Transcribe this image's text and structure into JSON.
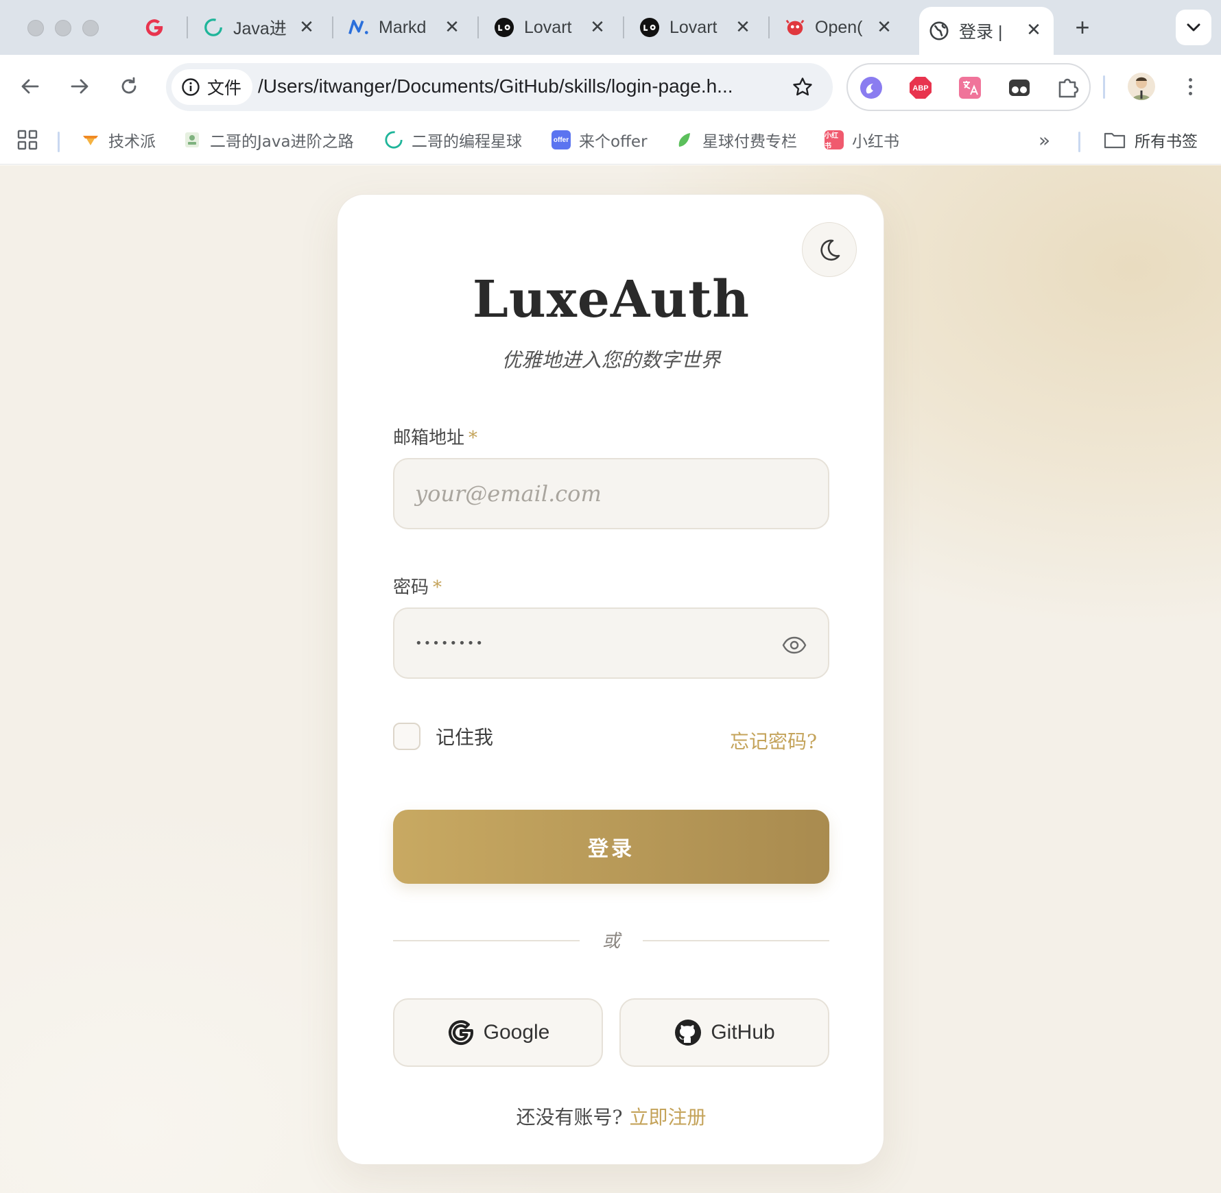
{
  "browser": {
    "tabs": [
      {
        "title": "",
        "icon": "google-g-icon"
      },
      {
        "title": "Java进",
        "icon": "spinner-icon"
      },
      {
        "title": "Markd",
        "icon": "markdown-n-icon"
      },
      {
        "title": "Lovart",
        "icon": "lovart-icon"
      },
      {
        "title": "Lovart",
        "icon": "lovart-icon"
      },
      {
        "title": "Open(",
        "icon": "red-mascot-icon"
      },
      {
        "title": "登录 |",
        "icon": "globe-icon",
        "active": true
      }
    ],
    "new_tab": "+",
    "address": {
      "chip_label": "文件",
      "url": "/Users/itwanger/Documents/GitHub/skills/login-page.h..."
    },
    "extensions": [
      "swirl-icon",
      "abp-icon",
      "translate-icon",
      "glasses-icon",
      "puzzle-icon"
    ],
    "abp_label": "ABP",
    "bookmarks": [
      {
        "label": "技术派",
        "color": "#f08a24"
      },
      {
        "label": "二哥的Java进阶之路",
        "color": "#7fb27f"
      },
      {
        "label": "二哥的编程星球",
        "color": "#1fb59a"
      },
      {
        "label": "来个offer",
        "color": "#5b74f0"
      },
      {
        "label": "星球付费专栏",
        "color": "#5bbf5b"
      },
      {
        "label": "小红书",
        "color": "#f05a6e"
      }
    ],
    "bookmarks_overflow": "»",
    "all_bookmarks": "所有书签"
  },
  "login": {
    "brand": "LuxeAuth",
    "tagline": "优雅地进入您的数字世界",
    "email": {
      "label": "邮箱地址",
      "required": "*",
      "placeholder": "your@email.com"
    },
    "password": {
      "label": "密码",
      "required": "*",
      "value": "••••••••"
    },
    "remember": "记住我",
    "forgot": "忘记密码?",
    "submit": "登录",
    "divider": "或",
    "social": [
      {
        "label": "Google",
        "icon": "google-icon"
      },
      {
        "label": "GitHub",
        "icon": "github-icon"
      }
    ],
    "signup_prompt": "还没有账号?",
    "signup_link": "立即注册"
  },
  "colors": {
    "accent_gold": "#c4a35a",
    "button_gradient_start": "#c8a962",
    "button_gradient_end": "#a98b4f",
    "page_bg": "#f4f0e8"
  }
}
